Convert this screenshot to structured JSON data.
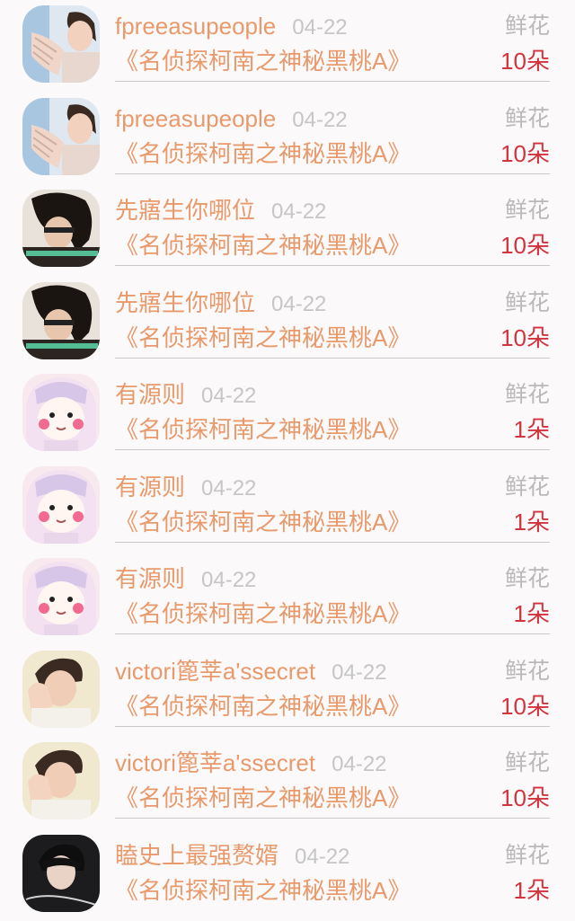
{
  "rows": [
    {
      "avatar": "avatar-man-hand-icon",
      "name": "fpreeasupeople",
      "date": "04-22",
      "gift": "《名侦探柯南之神秘黑桃A》",
      "type": "鲜花",
      "count": "10朵"
    },
    {
      "avatar": "avatar-man-hand-icon",
      "name": "fpreeasupeople",
      "date": "04-22",
      "gift": "《名侦探柯南之神秘黑桃A》",
      "type": "鲜花",
      "count": "10朵"
    },
    {
      "avatar": "avatar-girl-dark-icon",
      "name": "先寤生你哪位",
      "date": "04-22",
      "gift": "《名侦探柯南之神秘黑桃A》",
      "type": "鲜花",
      "count": "10朵"
    },
    {
      "avatar": "avatar-girl-dark-icon",
      "name": "先寤生你哪位",
      "date": "04-22",
      "gift": "《名侦探柯南之神秘黑桃A》",
      "type": "鲜花",
      "count": "10朵"
    },
    {
      "avatar": "avatar-anime-girl-icon",
      "name": "有源则",
      "date": "04-22",
      "gift": "《名侦探柯南之神秘黑桃A》",
      "type": "鲜花",
      "count": "1朵"
    },
    {
      "avatar": "avatar-anime-girl-icon",
      "name": "有源则",
      "date": "04-22",
      "gift": "《名侦探柯南之神秘黑桃A》",
      "type": "鲜花",
      "count": "1朵"
    },
    {
      "avatar": "avatar-anime-girl-icon",
      "name": "有源则",
      "date": "04-22",
      "gift": "《名侦探柯南之神秘黑桃A》",
      "type": "鲜花",
      "count": "1朵"
    },
    {
      "avatar": "avatar-boy-hand-icon",
      "name": "victori篦莘a'ssecret",
      "date": "04-22",
      "gift": "《名侦探柯南之神秘黑桃A》",
      "type": "鲜花",
      "count": "10朵"
    },
    {
      "avatar": "avatar-boy-hand-icon",
      "name": "victori篦莘a'ssecret",
      "date": "04-22",
      "gift": "《名侦探柯南之神秘黑桃A》",
      "type": "鲜花",
      "count": "10朵"
    },
    {
      "avatar": "avatar-boy-dark-icon",
      "name": "瞌史上最强赘婿",
      "date": "04-22",
      "gift": "《名侦探柯南之神秘黑桃A》",
      "type": "鲜花",
      "count": "1朵"
    }
  ]
}
